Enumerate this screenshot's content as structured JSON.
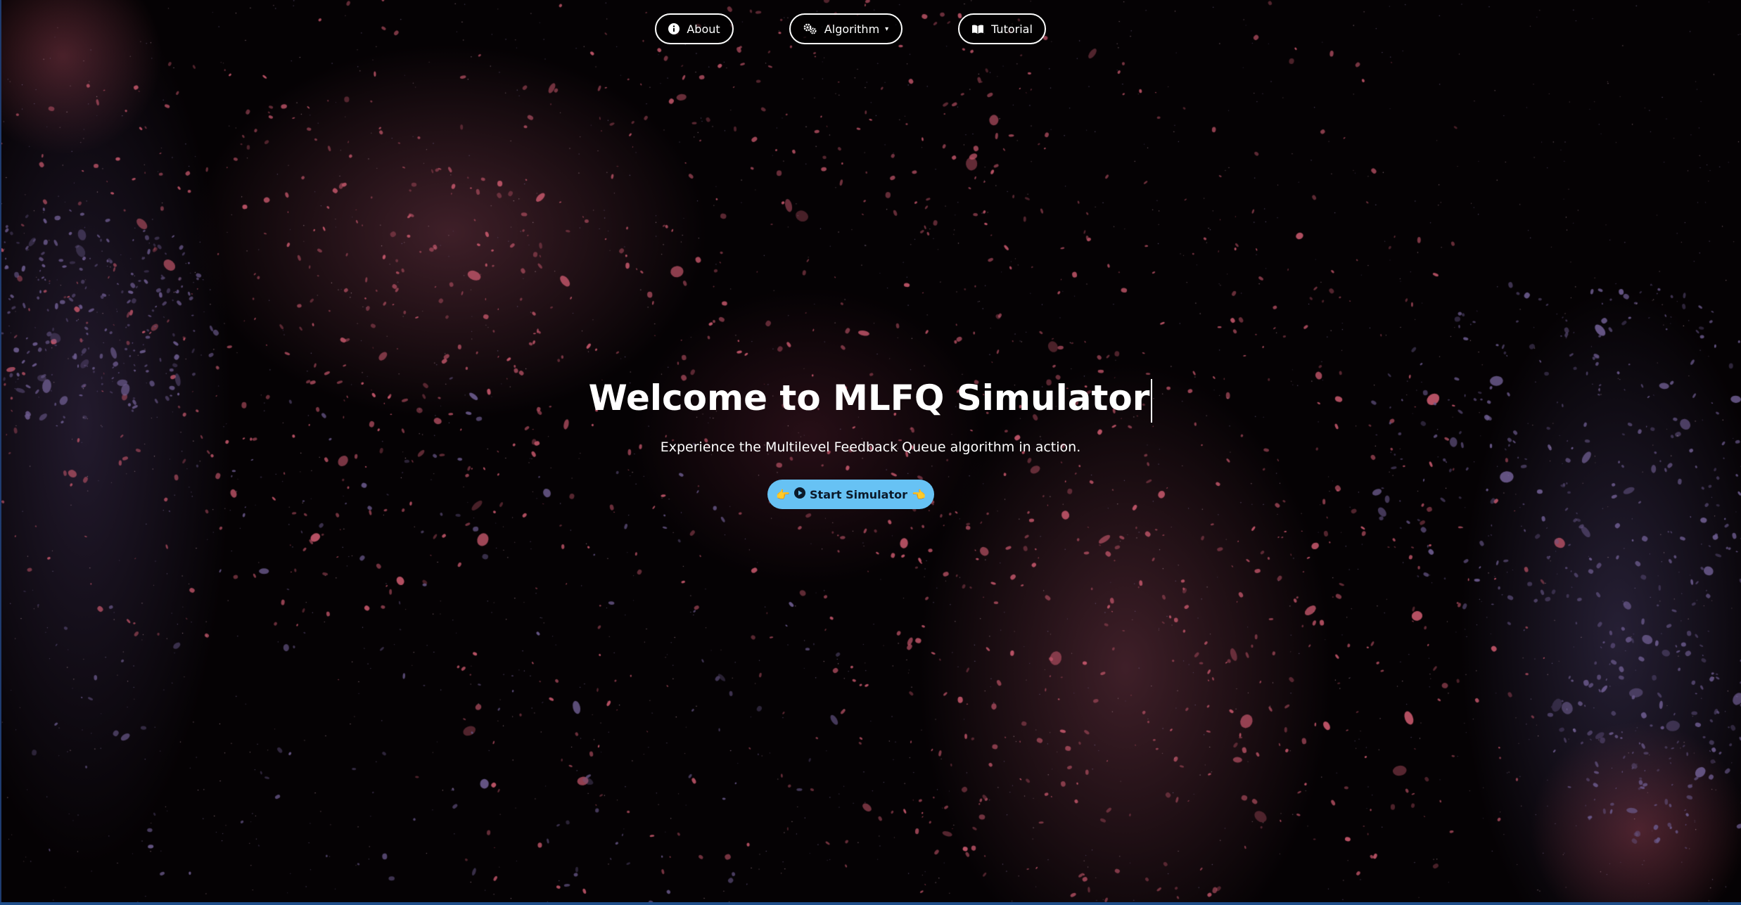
{
  "nav": {
    "about_label": "About",
    "algorithm_label": "Algorithm",
    "tutorial_label": "Tutorial",
    "about_icon": "info-circle-icon",
    "algorithm_icon": "gears-icon",
    "tutorial_icon": "book-open-icon",
    "algorithm_caret": "▾"
  },
  "hero": {
    "title": "Welcome to MLFQ Simulator",
    "subtitle": "Experience the Multilevel Feedback Queue algorithm in action.",
    "start_button_label": "Start Simulator",
    "start_button_left_emoji": "👉",
    "start_button_right_emoji": "👈",
    "start_button_icon": "play-circle-icon"
  },
  "colors": {
    "background": "#050204",
    "accent_button": "#67c2f4",
    "text": "#ffffff",
    "particles_warm": "#c2566a",
    "particles_cool": "#6b5a8c",
    "bottom_bar": "#1f4e8a"
  }
}
